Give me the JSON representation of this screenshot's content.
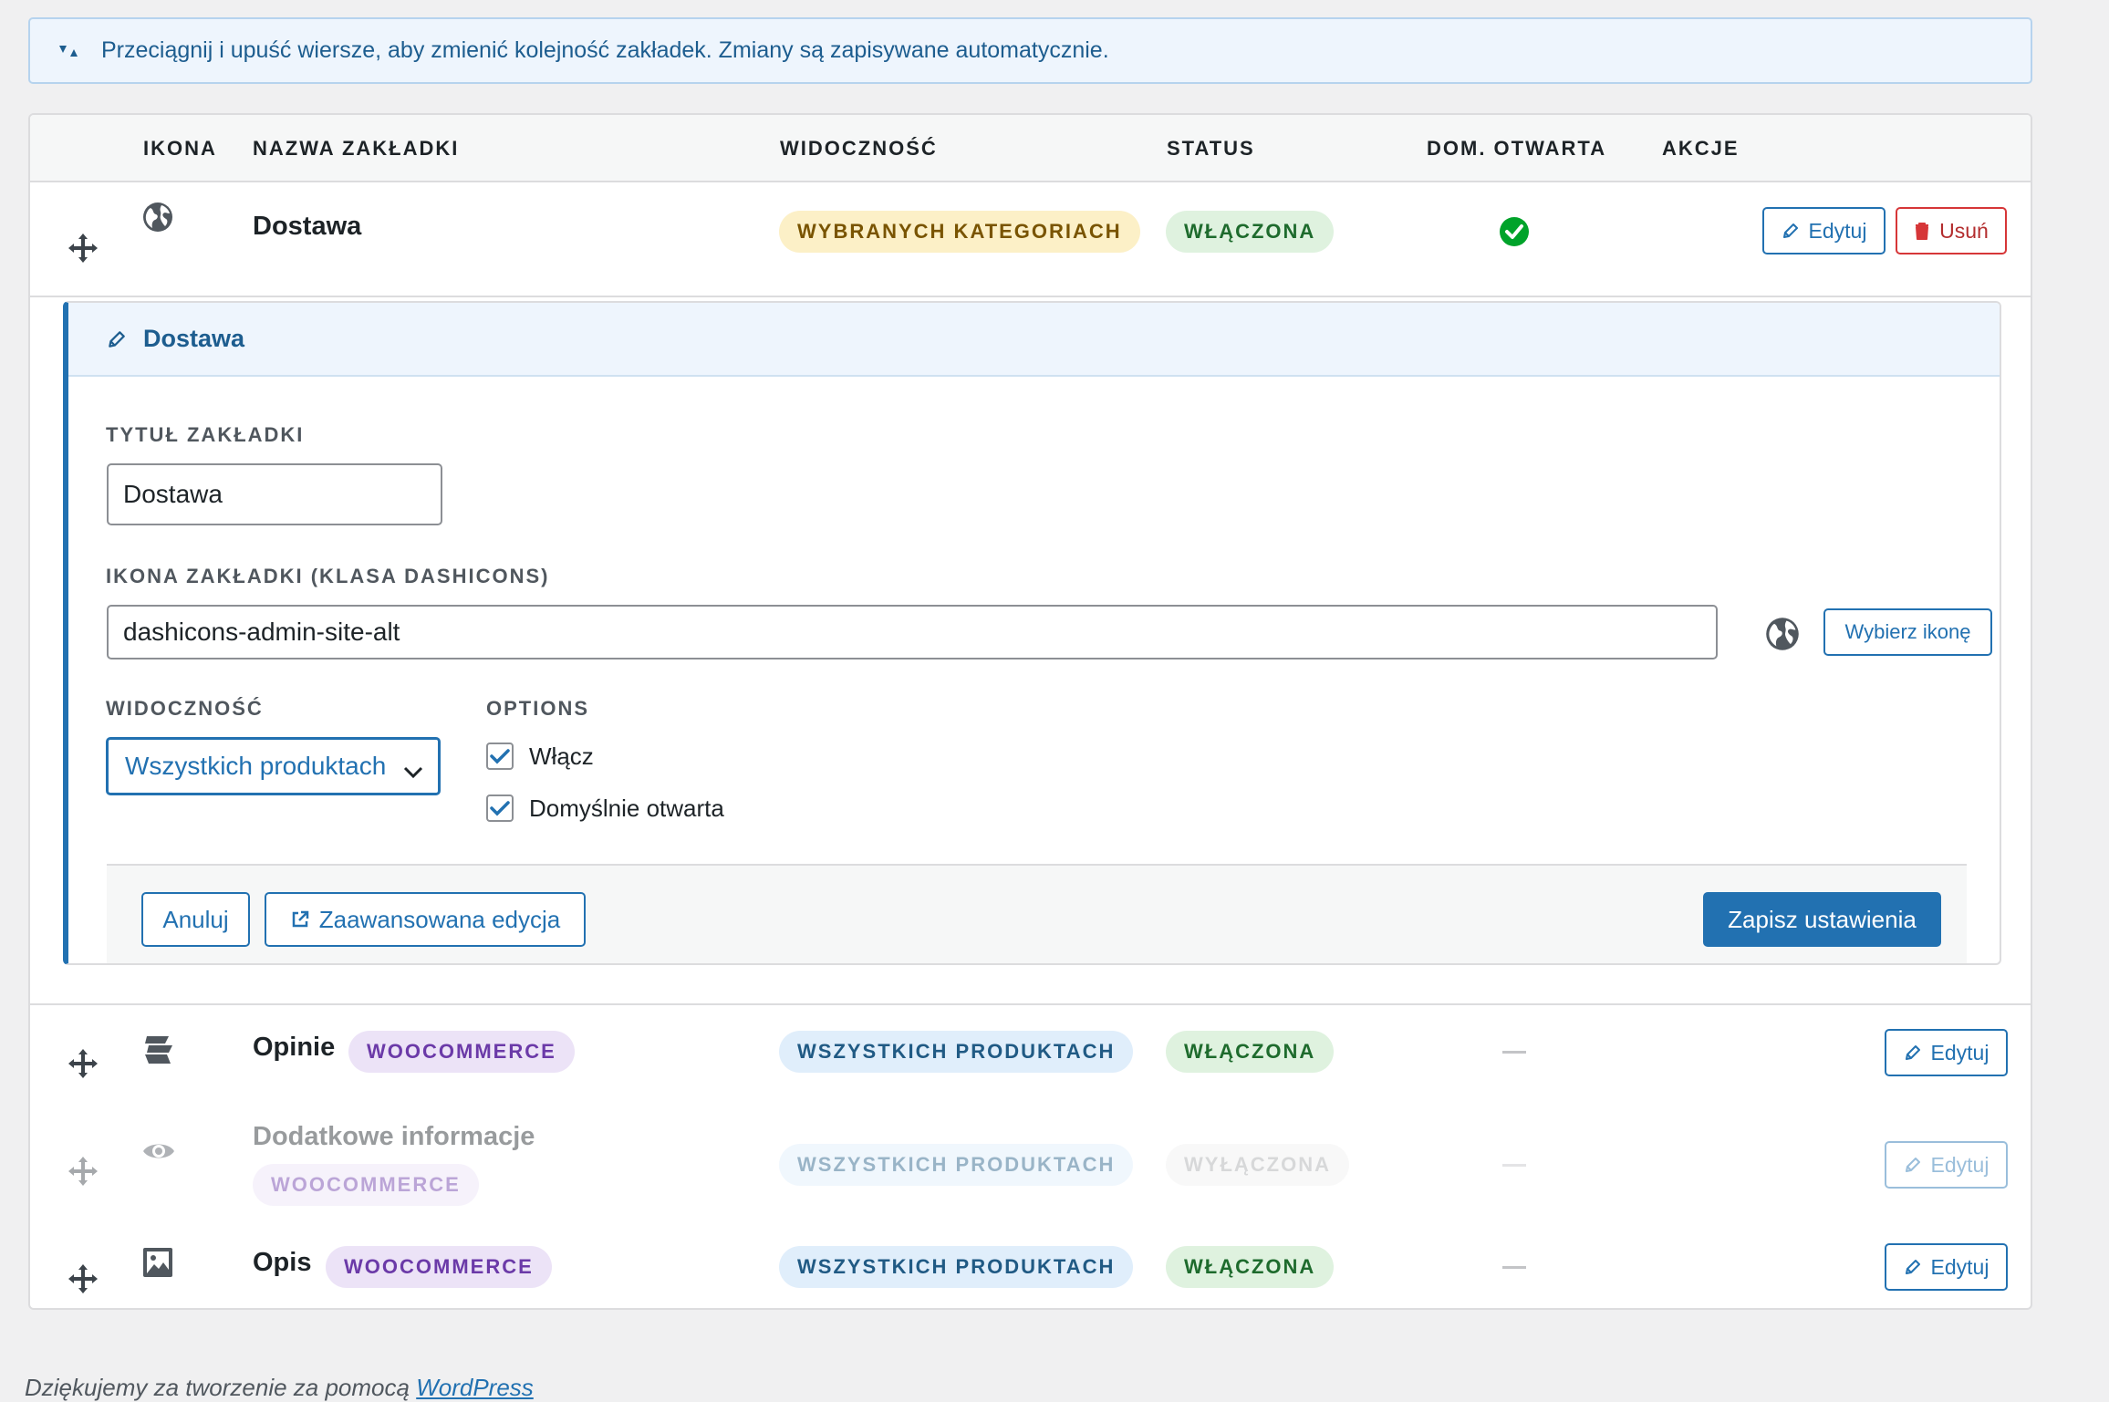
{
  "notice": {
    "text": "Przeciągnij i upuść wiersze, aby zmienić kolejność zakładek. Zmiany są zapisywane automatycznie."
  },
  "table": {
    "headers": {
      "icon": "IKONA",
      "name": "NAZWA ZAKŁADKI",
      "visibility": "WIDOCZNOŚĆ",
      "status": "STATUS",
      "default_open": "DOM. OTWARTA",
      "actions": "AKCJE"
    },
    "rows": [
      {
        "name": "Dostawa",
        "icon": "globe-icon",
        "visibility": "WYBRANYCH KATEGORIACH",
        "status": "WŁĄCZONA",
        "default_open": true,
        "edit_label": "Edytuj",
        "delete_label": "Usuń"
      },
      {
        "name": "Opinie",
        "badge": "WOOCOMMERCE",
        "icon": "reviews-icon",
        "visibility": "WSZYSTKICH PRODUKTACH",
        "status": "WŁĄCZONA",
        "default_open": false,
        "edit_label": "Edytuj"
      },
      {
        "name": "Dodatkowe informacje",
        "badge": "WOOCOMMERCE",
        "icon": "eye-icon",
        "visibility": "WSZYSTKICH PRODUKTACH",
        "status": "WYŁĄCZONA",
        "default_open": false,
        "edit_label": "Edytuj"
      },
      {
        "name": "Opis",
        "badge": "WOOCOMMERCE",
        "icon": "image-icon",
        "visibility": "WSZYSTKICH PRODUKTACH",
        "status": "WŁĄCZONA",
        "default_open": false,
        "edit_label": "Edytuj"
      }
    ]
  },
  "editor": {
    "title": "Dostawa",
    "title_label": "TYTUŁ ZAKŁADKI",
    "title_value": "Dostawa",
    "icon_label": "IKONA ZAKŁADKI (KLASA DASHICONS)",
    "icon_value": "dashicons-admin-site-alt",
    "choose_icon_label": "Wybierz ikonę",
    "visibility_label": "WIDOCZNOŚĆ",
    "visibility_value": "Wszystkich produktach",
    "options_label": "OPTIONS",
    "option_enable": "Włącz",
    "option_enable_checked": true,
    "option_default_open": "Domyślnie otwarta",
    "option_default_open_checked": true,
    "cancel_label": "Anuluj",
    "advanced_label": "Zaawansowana edycja",
    "save_label": "Zapisz ustawienia"
  },
  "footer": {
    "credit_prefix": "Dziękujemy za tworzenie za pomocą",
    "credit_link": "WordPress"
  },
  "colors": {
    "accent": "#2271b1",
    "success": "#00a32a",
    "danger": "#d63638"
  }
}
